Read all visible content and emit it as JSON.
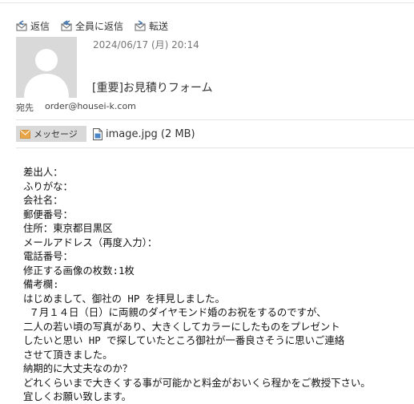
{
  "toolbar": {
    "reply_label": "返信",
    "reply_all_label": "全員に返信",
    "forward_label": "転送"
  },
  "header": {
    "date": "2024/06/17 (月) 20:14",
    "subject": "[重要]お見積りフォーム",
    "to_label": "宛先",
    "to_value": "order@housei-k.com"
  },
  "tabs": {
    "message_label": "メッセージ",
    "attachment_label": "image.jpg (2 MB)"
  },
  "body": {
    "lines": [
      "差出人：",
      "ふりがな：",
      "会社名：",
      "郵便番号：",
      "住所：東京都目黒区",
      "メールアドレス（再度入力）：",
      "電話番号：",
      "修正する画像の枚数:1枚",
      "備考欄:",
      "はじめまして、御社の HP を拝見しました。",
      " ７月１４日（日）に両親のダイヤモンド婚のお祝をするのですが、",
      "二人の若い頃の写真があり、大きくしてカラーにしたものをプレゼント",
      "したいと思い HP で探していたところ御社が一番良さそうに思いご連絡",
      "させて頂きました。",
      "納期的に大丈夫なのか？",
      "どれくらいまで大きくする事が可能かと料金がおいくら程かをご教授下さい。",
      "宜しくお願い致します。"
    ]
  },
  "colors": {
    "accent": "#3d6fa8",
    "icon_gray": "#8a8a8a",
    "tab_bg": "#d9d9d9",
    "mail_icon": "#e8a646"
  }
}
